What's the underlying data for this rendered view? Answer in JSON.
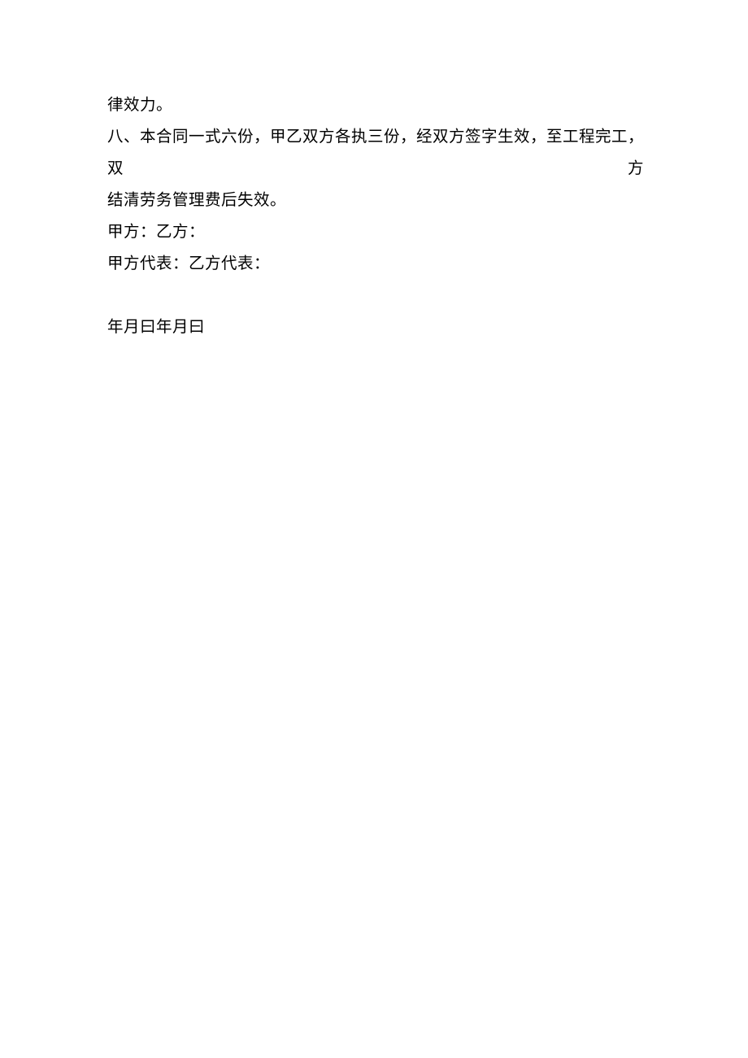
{
  "document": {
    "line1": "律效力。",
    "line2": "八、本合同一式六份，甲乙双方各执三份，经双方签字生效，至工程完工，双方",
    "line3": "结清劳务管理费后失效。",
    "line4": "甲方：乙方：",
    "line5": "甲方代表：乙方代表：",
    "line6": "年月曰年月曰"
  }
}
